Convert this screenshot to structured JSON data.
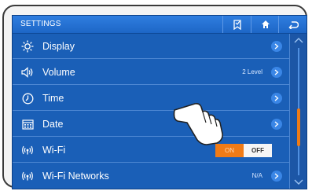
{
  "header": {
    "title": "SETTINGS"
  },
  "rows": [
    {
      "label": "Display",
      "icon": "brightness-icon",
      "value": ""
    },
    {
      "label": "Volume",
      "icon": "speaker-icon",
      "value": "2 Level"
    },
    {
      "label": "Time",
      "icon": "clock-icon",
      "value": ""
    },
    {
      "label": "Date",
      "icon": "calendar-icon",
      "value": ""
    },
    {
      "label": "Wi-Fi",
      "icon": "wifi-icon",
      "toggle": {
        "on_label": "ON",
        "off_label": "OFF",
        "selected": "OFF"
      }
    },
    {
      "label": "Wi-Fi Networks",
      "icon": "wifi-icon",
      "value": "N/A"
    }
  ],
  "colors": {
    "screen_bg": "#1a5fb7",
    "accent": "#f07b16"
  }
}
